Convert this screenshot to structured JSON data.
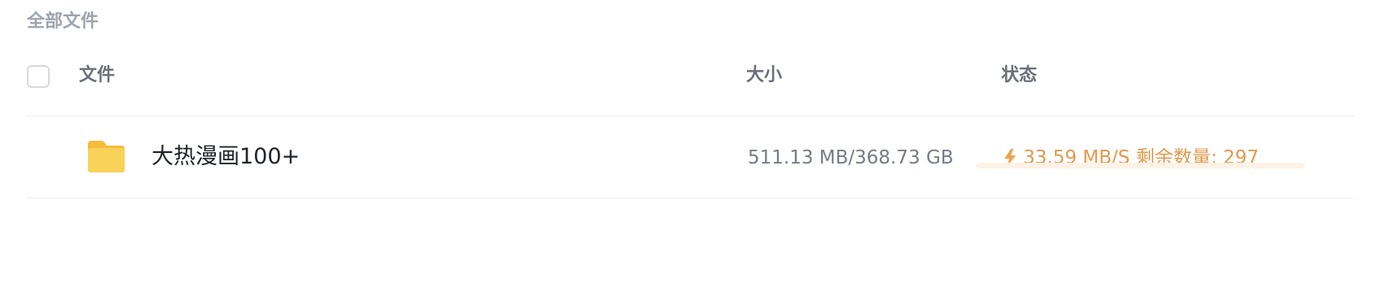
{
  "breadcrumb": {
    "label": "全部文件"
  },
  "table": {
    "columns": {
      "file": "文件",
      "size": "大小",
      "status": "状态"
    },
    "rows": [
      {
        "icon": "folder-icon",
        "name": "大热漫画100+",
        "size": "511.13 MB/368.73 GB",
        "status": {
          "icon": "lightning-bolt-icon",
          "text": "33.59 MB/S 剩余数量: 297",
          "progress": 0.0014
        }
      }
    ]
  },
  "colors": {
    "accent": "#e29a4f",
    "folder": "#f7c948",
    "muted": "#9ea3ad"
  }
}
